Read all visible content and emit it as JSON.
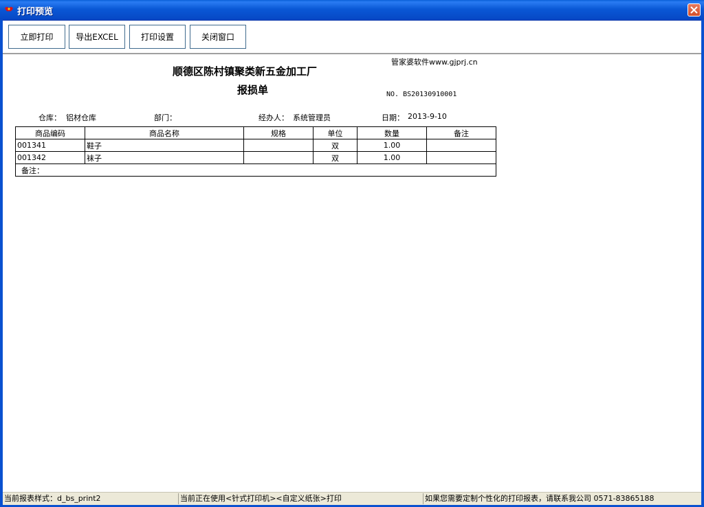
{
  "window": {
    "title": "打印预览",
    "icon": "app-icon",
    "close_icon": "close-icon"
  },
  "toolbar": {
    "print_now": "立即打印",
    "export_excel": "导出EXCEL",
    "print_settings": "打印设置",
    "close_window": "关闭窗口"
  },
  "report": {
    "watermark": "管家婆软件www.gjprj.cn",
    "company": "顺德区陈村镇聚类新五金加工厂",
    "title": "报损单",
    "number": "NO. BS20130910001",
    "warehouse_label": "仓库：",
    "warehouse_value": "铝材仓库",
    "department_label": "部门：",
    "department_value": "",
    "handler_label": "经办人：",
    "handler_value": "系统管理员",
    "date_label": "日期：",
    "date_value": "2013-9-10",
    "columns": [
      "商品编码",
      "商品名称",
      "规格",
      "单位",
      "数量",
      "备注"
    ],
    "rows": [
      {
        "code": "001341",
        "name": "鞋子",
        "spec": "",
        "unit": "双",
        "qty": "1.00",
        "note": ""
      },
      {
        "code": "001342",
        "name": "袜子",
        "spec": "",
        "unit": "双",
        "qty": "1.00",
        "note": ""
      }
    ],
    "footer_note_label": "备注："
  },
  "statusbar": {
    "style": "当前报表样式：d_bs_print2",
    "printer": "当前正在使用<针式打印机><自定义纸张>打印",
    "contact": "如果您需要定制个性化的打印报表，请联系我公司 0571-83865188"
  },
  "colors": {
    "titlebar": "#0a58d6",
    "button_border": "#3f6a8d",
    "statusbar": "#ece9d8"
  }
}
